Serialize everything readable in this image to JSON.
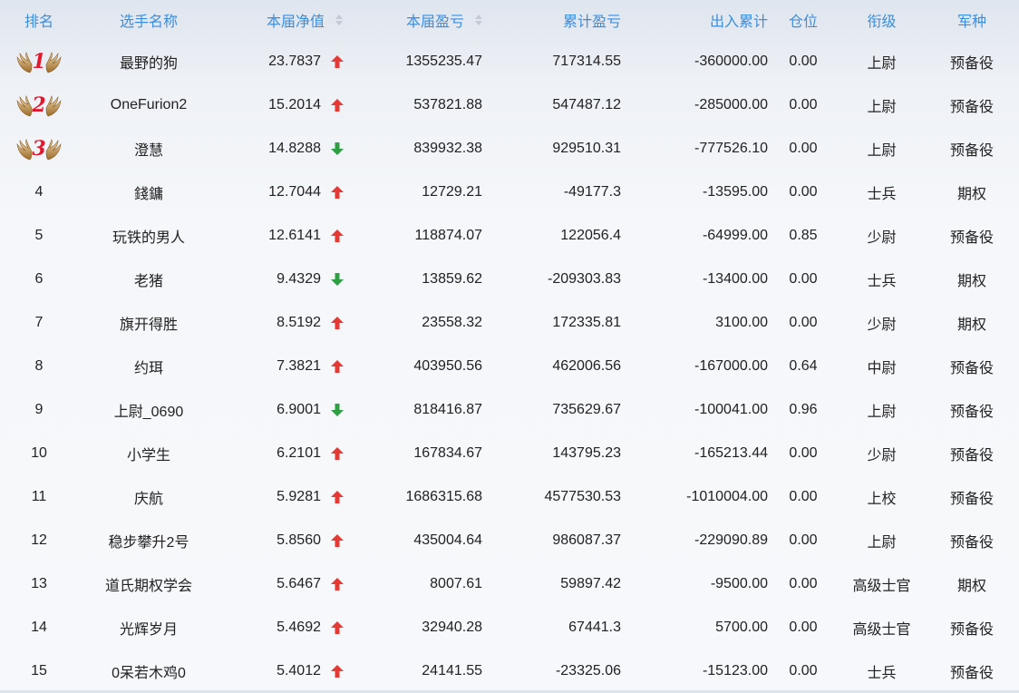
{
  "header": {
    "rank": "排名",
    "name": "选手名称",
    "nav": "本届净值",
    "season_pnl": "本届盈亏",
    "total_pnl": "累计盈亏",
    "cash_flow": "出入累计",
    "position": "仓位",
    "grade": "衔级",
    "type": "军种"
  },
  "colors": {
    "header_text": "#3a8ee0",
    "up_arrow": "#e53935",
    "down_arrow": "#2ea043",
    "medal_number": "#e3172e"
  },
  "rows": [
    {
      "rank": "1",
      "medal": true,
      "name": "最野的狗",
      "nav": "23.7837",
      "trend": "up",
      "season": "1355235.47",
      "total": "717314.55",
      "flow": "-360000.00",
      "pos": "0.00",
      "grade": "上尉",
      "type": "预备役"
    },
    {
      "rank": "2",
      "medal": true,
      "name": "OneFurion2",
      "nav": "15.2014",
      "trend": "up",
      "season": "537821.88",
      "total": "547487.12",
      "flow": "-285000.00",
      "pos": "0.00",
      "grade": "上尉",
      "type": "预备役"
    },
    {
      "rank": "3",
      "medal": true,
      "name": "澄慧",
      "nav": "14.8288",
      "trend": "down",
      "season": "839932.38",
      "total": "929510.31",
      "flow": "-777526.10",
      "pos": "0.00",
      "grade": "上尉",
      "type": "预备役"
    },
    {
      "rank": "4",
      "medal": false,
      "name": "錢鏞",
      "nav": "12.7044",
      "trend": "up",
      "season": "12729.21",
      "total": "-49177.3",
      "flow": "-13595.00",
      "pos": "0.00",
      "grade": "士兵",
      "type": "期权"
    },
    {
      "rank": "5",
      "medal": false,
      "name": "玩铁的男人",
      "nav": "12.6141",
      "trend": "up",
      "season": "118874.07",
      "total": "122056.4",
      "flow": "-64999.00",
      "pos": "0.85",
      "grade": "少尉",
      "type": "预备役"
    },
    {
      "rank": "6",
      "medal": false,
      "name": "老猪",
      "nav": "9.4329",
      "trend": "down",
      "season": "13859.62",
      "total": "-209303.83",
      "flow": "-13400.00",
      "pos": "0.00",
      "grade": "士兵",
      "type": "期权"
    },
    {
      "rank": "7",
      "medal": false,
      "name": "旗开得胜",
      "nav": "8.5192",
      "trend": "up",
      "season": "23558.32",
      "total": "172335.81",
      "flow": "3100.00",
      "pos": "0.00",
      "grade": "少尉",
      "type": "期权"
    },
    {
      "rank": "8",
      "medal": false,
      "name": "约珥",
      "nav": "7.3821",
      "trend": "up",
      "season": "403950.56",
      "total": "462006.56",
      "flow": "-167000.00",
      "pos": "0.64",
      "grade": "中尉",
      "type": "预备役"
    },
    {
      "rank": "9",
      "medal": false,
      "name": "上尉_0690",
      "nav": "6.9001",
      "trend": "down",
      "season": "818416.87",
      "total": "735629.67",
      "flow": "-100041.00",
      "pos": "0.96",
      "grade": "上尉",
      "type": "预备役"
    },
    {
      "rank": "10",
      "medal": false,
      "name": "小学生",
      "nav": "6.2101",
      "trend": "up",
      "season": "167834.67",
      "total": "143795.23",
      "flow": "-165213.44",
      "pos": "0.00",
      "grade": "少尉",
      "type": "预备役"
    },
    {
      "rank": "11",
      "medal": false,
      "name": "庆航",
      "nav": "5.9281",
      "trend": "up",
      "season": "1686315.68",
      "total": "4577530.53",
      "flow": "-1010004.00",
      "pos": "0.00",
      "grade": "上校",
      "type": "预备役"
    },
    {
      "rank": "12",
      "medal": false,
      "name": "稳步攀升2号",
      "nav": "5.8560",
      "trend": "up",
      "season": "435004.64",
      "total": "986087.37",
      "flow": "-229090.89",
      "pos": "0.00",
      "grade": "上尉",
      "type": "预备役"
    },
    {
      "rank": "13",
      "medal": false,
      "name": "道氏期权学会",
      "nav": "5.6467",
      "trend": "up",
      "season": "8007.61",
      "total": "59897.42",
      "flow": "-9500.00",
      "pos": "0.00",
      "grade": "高级士官",
      "type": "期权"
    },
    {
      "rank": "14",
      "medal": false,
      "name": "光辉岁月",
      "nav": "5.4692",
      "trend": "up",
      "season": "32940.28",
      "total": "67441.3",
      "flow": "5700.00",
      "pos": "0.00",
      "grade": "高级士官",
      "type": "预备役"
    },
    {
      "rank": "15",
      "medal": false,
      "name": "0呆若木鸡0",
      "nav": "5.4012",
      "trend": "up",
      "season": "24141.55",
      "total": "-23325.06",
      "flow": "-15123.00",
      "pos": "0.00",
      "grade": "士兵",
      "type": "预备役"
    }
  ]
}
